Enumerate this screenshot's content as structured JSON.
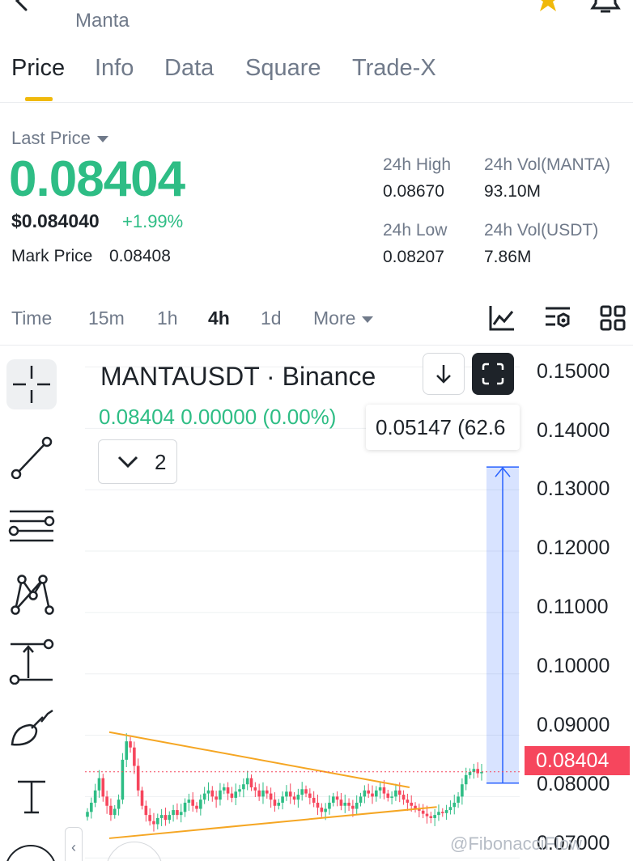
{
  "header": {
    "subtitle": "Manta",
    "icons": [
      "back-arrow-icon",
      "star-icon",
      "bell-icon"
    ],
    "star_color": "#f0b90b"
  },
  "tabs": [
    {
      "label": "Price",
      "active": true
    },
    {
      "label": "Info",
      "active": false
    },
    {
      "label": "Data",
      "active": false
    },
    {
      "label": "Square",
      "active": false
    },
    {
      "label": "Trade-X",
      "active": false
    }
  ],
  "price": {
    "last_price_label": "Last Price",
    "last_price": "0.08404",
    "usd_price": "$0.084040",
    "change": "+1.99%",
    "mark_price_label": "Mark Price",
    "mark_price": "0.08408",
    "up_color": "#2ebd85"
  },
  "stats": {
    "high_label": "24h High",
    "high_value": "0.08670",
    "vol_base_label": "24h Vol(MANTA)",
    "vol_base_value": "93.10M",
    "low_label": "24h Low",
    "low_value": "0.08207",
    "vol_quote_label": "24h Vol(USDT)",
    "vol_quote_value": "7.86M"
  },
  "intervals": {
    "items": [
      "Time",
      "15m",
      "1h",
      "4h",
      "1d",
      "More"
    ],
    "active": "4h",
    "tool_icons": [
      "indicator-chart-icon",
      "chart-settings-icon",
      "layout-grid-icon"
    ]
  },
  "left_tools": [
    "crosshair-icon",
    "trend-line-icon",
    "horizontal-lines-icon",
    "pattern-icon",
    "measure-icon",
    "brush-icon",
    "text-icon"
  ],
  "chart": {
    "title": "MANTAUSDT · Binance",
    "ohlc_line": "0.08404  0.00000 (0.00%)",
    "collapse_count": "2",
    "measure_tip": "0.05147 (62.6",
    "current_price_tag": "0.08404",
    "down_color": "#f6465d",
    "watermark": "@FibonacciFlow"
  },
  "chart_data": {
    "type": "candlestick",
    "title": "MANTAUSDT · Binance",
    "y_ticks": [
      "0.15000",
      "0.14000",
      "0.13000",
      "0.12000",
      "0.11000",
      "0.10000",
      "0.09000",
      "0.08000",
      "0.07000"
    ],
    "ylim": [
      0.0695,
      0.1535
    ],
    "grid": true,
    "last_price": 0.08404,
    "annotations": [
      {
        "type": "trendline",
        "color": "#f5a623",
        "from": [
          0.08,
          0.0905
        ],
        "to": [
          0.74,
          0.0815
        ]
      },
      {
        "type": "trendline",
        "color": "#f5a623",
        "from": [
          0.08,
          0.0732
        ],
        "to": [
          0.8,
          0.0783
        ]
      },
      {
        "type": "price-range",
        "color": "#2962ff",
        "from": 0.0822,
        "to": 0.1337,
        "label": "0.05147 (62.6"
      }
    ],
    "closes": [
      0.0775,
      0.079,
      0.081,
      0.083,
      0.08,
      0.0785,
      0.077,
      0.078,
      0.0795,
      0.086,
      0.089,
      0.088,
      0.085,
      0.081,
      0.0785,
      0.077,
      0.076,
      0.0755,
      0.0765,
      0.077,
      0.0762,
      0.077,
      0.0778,
      0.077,
      0.0775,
      0.079,
      0.0795,
      0.0785,
      0.078,
      0.0795,
      0.0805,
      0.081,
      0.08,
      0.0795,
      0.081,
      0.0815,
      0.0805,
      0.0798,
      0.0808,
      0.0812,
      0.082,
      0.083,
      0.0815,
      0.081,
      0.08,
      0.081,
      0.0805,
      0.0795,
      0.0785,
      0.079,
      0.08,
      0.0808,
      0.08,
      0.0795,
      0.0803,
      0.0812,
      0.0805,
      0.0798,
      0.079,
      0.0782,
      0.0775,
      0.078,
      0.079,
      0.08,
      0.0795,
      0.0785,
      0.079,
      0.0785,
      0.078,
      0.079,
      0.08,
      0.081,
      0.0805,
      0.08,
      0.081,
      0.0815,
      0.0805,
      0.0798,
      0.08,
      0.081,
      0.0803,
      0.0795,
      0.079,
      0.0785,
      0.078,
      0.0777,
      0.0772,
      0.0768,
      0.0765,
      0.077,
      0.0775,
      0.0773,
      0.0778,
      0.0783,
      0.079,
      0.08,
      0.082,
      0.0835,
      0.084,
      0.0845,
      0.0838,
      0.084
    ]
  }
}
